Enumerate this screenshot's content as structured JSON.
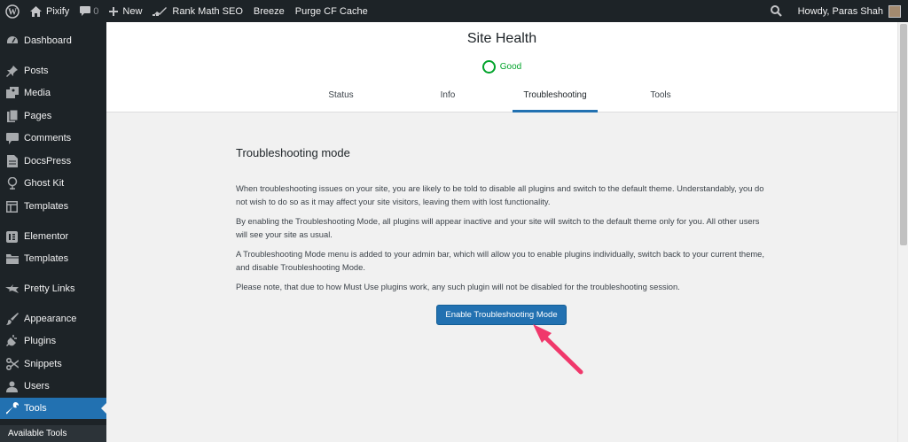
{
  "admin_bar": {
    "site_name": "Pixify",
    "comments_count": "0",
    "new_label": "New",
    "rank_math_label": "Rank Math SEO",
    "breeze_label": "Breeze",
    "purge_label": "Purge CF Cache",
    "greeting": "Howdy, Paras Shah"
  },
  "sidebar": {
    "items": [
      {
        "label": "Dashboard",
        "icon": "dashboard-icon"
      },
      {
        "label": "Posts",
        "icon": "pin-icon"
      },
      {
        "label": "Media",
        "icon": "media-icon"
      },
      {
        "label": "Pages",
        "icon": "pages-icon"
      },
      {
        "label": "Comments",
        "icon": "comment-icon"
      },
      {
        "label": "DocsPress",
        "icon": "document-icon"
      },
      {
        "label": "Ghost Kit",
        "icon": "ghost-icon"
      },
      {
        "label": "Templates",
        "icon": "template-icon"
      },
      {
        "label": "Elementor",
        "icon": "elementor-icon"
      },
      {
        "label": "Templates",
        "icon": "folder-icon"
      },
      {
        "label": "Pretty Links",
        "icon": "star-icon"
      },
      {
        "label": "Appearance",
        "icon": "brush-icon"
      },
      {
        "label": "Plugins",
        "icon": "plugin-icon"
      },
      {
        "label": "Snippets",
        "icon": "scissors-icon"
      },
      {
        "label": "Users",
        "icon": "users-icon"
      },
      {
        "label": "Tools",
        "icon": "wrench-icon"
      }
    ],
    "submenu_first": "Available Tools"
  },
  "header": {
    "title": "Site Health",
    "status": "Good",
    "tabs": [
      {
        "label": "Status"
      },
      {
        "label": "Info"
      },
      {
        "label": "Troubleshooting"
      },
      {
        "label": "Tools"
      }
    ]
  },
  "troubleshooting": {
    "heading": "Troubleshooting mode",
    "paragraphs": [
      "When troubleshooting issues on your site, you are likely to be told to disable all plugins and switch to the default theme. Understandably, you do not wish to do so as it may affect your site visitors, leaving them with lost functionality.",
      "By enabling the Troubleshooting Mode, all plugins will appear inactive and your site will switch to the default theme only for you. All other users will see your site as usual.",
      "A Troubleshooting Mode menu is added to your admin bar, which will allow you to enable plugins individually, switch back to your current theme, and disable Troubleshooting Mode.",
      "Please note, that due to how Must Use plugins work, any such plugin will not be disabled for the troubleshooting session."
    ],
    "button_label": "Enable Troubleshooting Mode"
  },
  "colors": {
    "admin_dark": "#1d2327",
    "accent": "#2271b1",
    "good": "#00a32a",
    "arrow": "#f0386b"
  }
}
